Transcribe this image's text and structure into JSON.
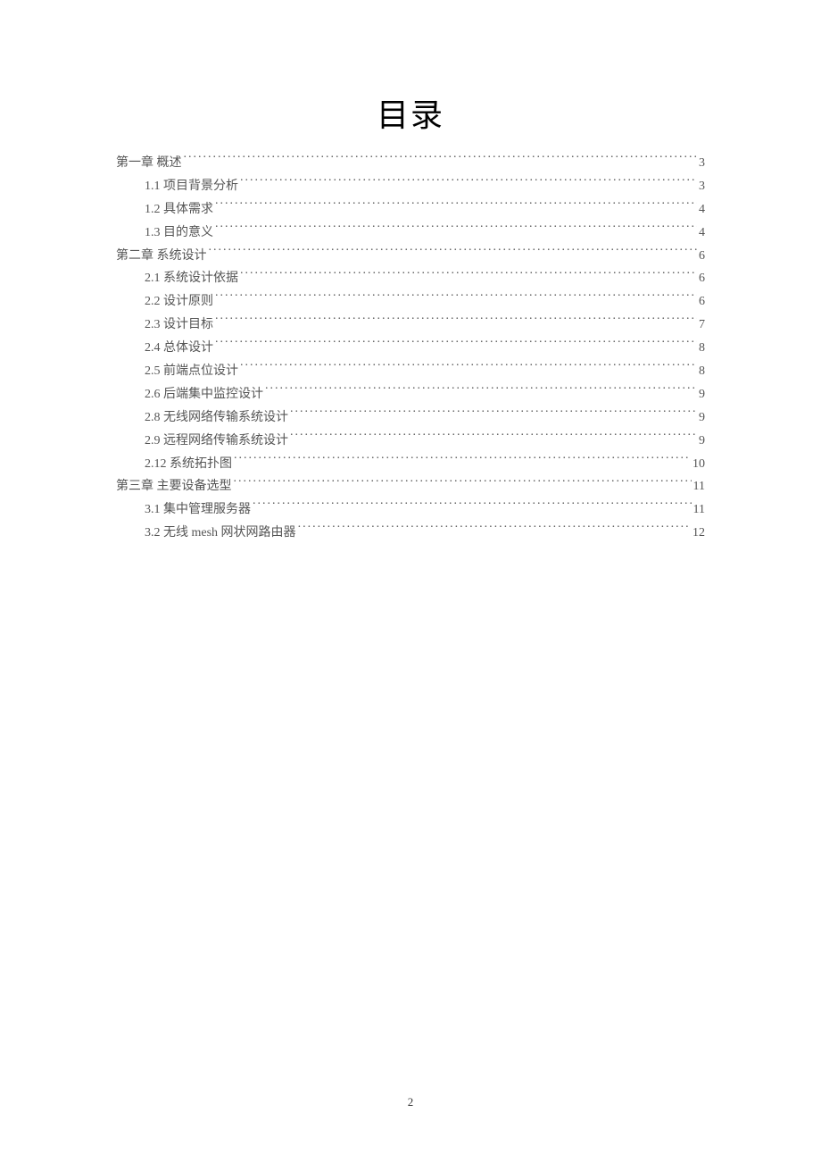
{
  "title": "目录",
  "page_number": "2",
  "toc": [
    {
      "level": 1,
      "label": "第一章  概述",
      "page": "3"
    },
    {
      "level": 2,
      "label": "1.1  项目背景分析",
      "page": "3"
    },
    {
      "level": 2,
      "label": "1.2 具体需求",
      "page": "4"
    },
    {
      "level": 2,
      "label": "1.3 目的意义",
      "page": "4"
    },
    {
      "level": 1,
      "label": "第二章  系统设计",
      "page": "6"
    },
    {
      "level": 2,
      "label": "2.1  系统设计依据",
      "page": "6"
    },
    {
      "level": 2,
      "label": "2.2  设计原则",
      "page": "6"
    },
    {
      "level": 2,
      "label": "2.3  设计目标",
      "page": "7"
    },
    {
      "level": 2,
      "label": "2.4  总体设计",
      "page": "8"
    },
    {
      "level": 2,
      "label": "2.5  前端点位设计",
      "page": "8"
    },
    {
      "level": 2,
      "label": "2.6  后端集中监控设计",
      "page": "9"
    },
    {
      "level": 2,
      "label": "2.8  无线网络传输系统设计",
      "page": "9"
    },
    {
      "level": 2,
      "label": "2.9  远程网络传输系统设计",
      "page": "9"
    },
    {
      "level": 2,
      "label": "2.12  系统拓扑图",
      "page": "10"
    },
    {
      "level": 1,
      "label": "第三章  主要设备选型",
      "page": "11"
    },
    {
      "level": 2,
      "label": "3.1  集中管理服务器",
      "page": "11"
    },
    {
      "level": 2,
      "label": "3.2  无线 mesh 网状网路由器",
      "page": "12"
    }
  ]
}
